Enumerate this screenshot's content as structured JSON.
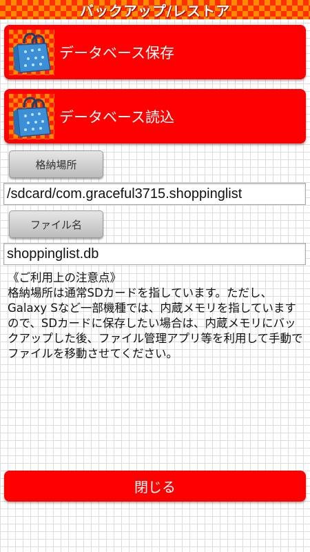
{
  "app": {
    "title": "バックアップ/レストア"
  },
  "actions": {
    "save_label": "データベース保存",
    "save_icon": "shopping-bag-icon",
    "load_label": "データベース読込",
    "load_icon": "shopping-bag-icon"
  },
  "storage": {
    "label": "格納場所",
    "value": "/sdcard/com.graceful3715.shoppinglist"
  },
  "file": {
    "label": "ファイル名",
    "value": "shoppinglist.db"
  },
  "notes": {
    "heading": "《ご利用上の注意点》",
    "body": "格納場所は通常SDカードを指しています。ただし、Galaxy Sなど一部機種では、内蔵メモリを指していますので、SDカードに保存したい場合は、内蔵メモリにバックアップした後、ファイル管理アプリ等を利用して手動でファイルを移動させてください。"
  },
  "footer": {
    "close_label": "閉じる"
  },
  "colors": {
    "accent": "#ff0000",
    "title_check_a": "#ff3000",
    "title_check_b": "#ff8a00",
    "bag": "#3a8fd6"
  }
}
